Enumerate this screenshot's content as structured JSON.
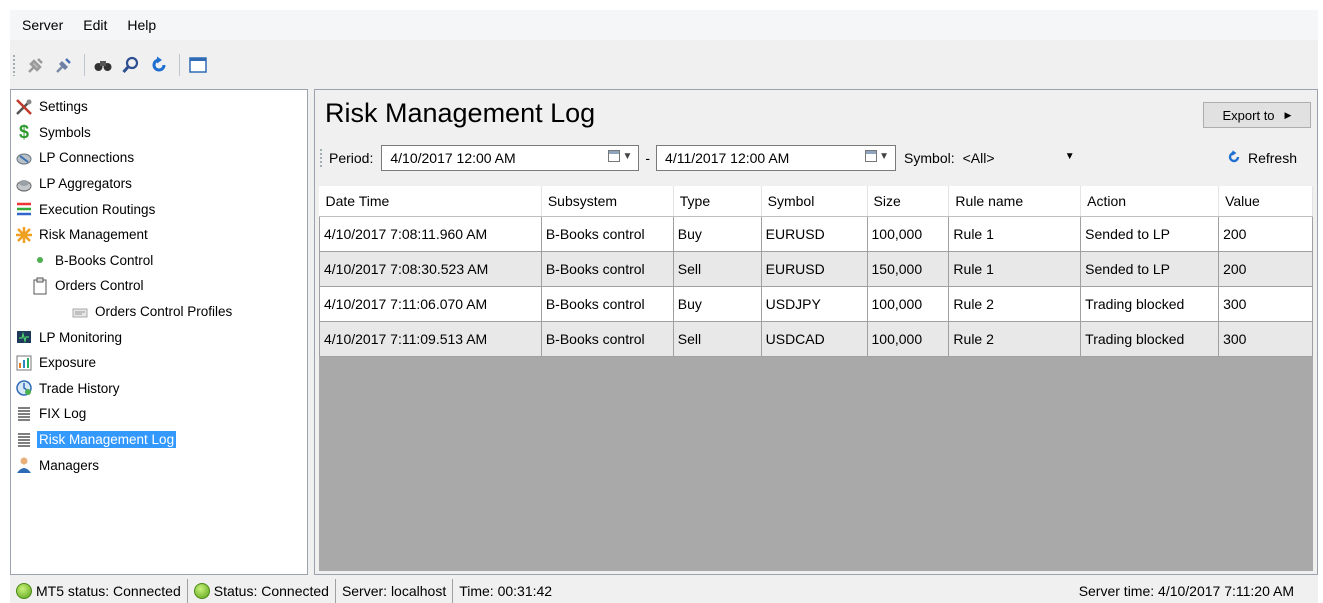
{
  "menu": [
    "Server",
    "Edit",
    "Help"
  ],
  "toolbar": {
    "icons": [
      "connect-icon",
      "disconnect-icon",
      "binoculars-icon",
      "search-icon",
      "refresh-icon",
      "window-icon"
    ]
  },
  "tree": {
    "items": [
      {
        "label": "Settings",
        "icon": "settings-icon"
      },
      {
        "label": "Symbols",
        "icon": "dollar-icon"
      },
      {
        "label": "LP Connections",
        "icon": "lp-connections-icon"
      },
      {
        "label": "LP Aggregators",
        "icon": "lp-aggregators-icon"
      },
      {
        "label": "Execution Routings",
        "icon": "execution-routings-icon"
      },
      {
        "label": "Risk Management",
        "icon": "risk-management-icon"
      },
      {
        "label": "B-Books Control",
        "icon": "bullet-icon"
      },
      {
        "label": "Orders Control",
        "icon": "clipboard-icon"
      },
      {
        "label": "Orders Control Profiles",
        "icon": "profile-icon"
      },
      {
        "label": "LP Monitoring",
        "icon": "monitor-icon"
      },
      {
        "label": "Exposure",
        "icon": "chart-icon"
      },
      {
        "label": "Trade History",
        "icon": "history-icon"
      },
      {
        "label": "FIX Log",
        "icon": "log-icon"
      },
      {
        "label": "Risk Management Log",
        "icon": "log-icon"
      },
      {
        "label": "Managers",
        "icon": "user-icon"
      }
    ],
    "selected": "Risk Management Log"
  },
  "main": {
    "title": "Risk Management Log",
    "export_label": "Export to",
    "filter": {
      "period_label": "Period:",
      "from": "4/10/2017 12:00 AM",
      "separator": "-",
      "to": "4/11/2017 12:00 AM",
      "symbol_label": "Symbol:",
      "symbol_value": "<All>",
      "refresh_label": "Refresh"
    },
    "table": {
      "columns": [
        "Date Time",
        "Subsystem",
        "Type",
        "Symbol",
        "Size",
        "Rule name",
        "Action",
        "Value"
      ],
      "rows": [
        [
          "4/10/2017 7:08:11.960 AM",
          "B-Books control",
          "Buy",
          "EURUSD",
          "100,000",
          "Rule 1",
          "Sended to LP",
          "200"
        ],
        [
          "4/10/2017 7:08:30.523 AM",
          "B-Books control",
          "Sell",
          "EURUSD",
          "150,000",
          "Rule 1",
          "Sended to LP",
          "200"
        ],
        [
          "4/10/2017 7:11:06.070 AM",
          "B-Books control",
          "Buy",
          "USDJPY",
          "100,000",
          "Rule 2",
          "Trading blocked",
          "300"
        ],
        [
          "4/10/2017 7:11:09.513 AM",
          "B-Books control",
          "Sell",
          "USDCAD",
          "100,000",
          "Rule 2",
          "Trading blocked",
          "300"
        ]
      ]
    }
  },
  "status": {
    "mt5": "MT5 status: Connected",
    "status": "Status: Connected",
    "server": "Server: localhost",
    "time": "Time: 00:31:42",
    "server_time": "Server time: 4/10/2017 7:11:20 AM"
  },
  "colors": {
    "selection": "#3399ff",
    "grid_background": "#a9a9a9",
    "status_ok": "#5aa11a"
  }
}
